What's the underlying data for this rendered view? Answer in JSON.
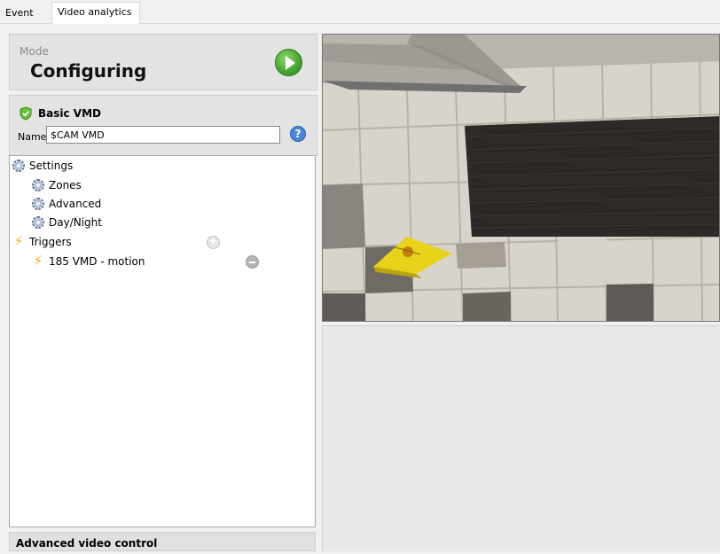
{
  "tabs": [
    {
      "label": "Event"
    },
    {
      "label": "Video analytics"
    }
  ],
  "mode": {
    "label": "Mode",
    "value": "Configuring",
    "play_icon": "play-icon"
  },
  "vmd": {
    "title": "Basic VMD",
    "name_label": "Name",
    "name_value": "$CAM VMD",
    "help_icon": "help-icon"
  },
  "tree": {
    "settings": "Settings",
    "zones": "Zones",
    "advanced": "Advanced",
    "day_night": "Day/Night",
    "triggers": "Triggers",
    "trigger_item": "185 VMD - motion"
  },
  "advanced_video_control": "Advanced video control",
  "colors": {
    "play": "#4aa632",
    "help": "#4a86d8",
    "trigger_bolt": "#f2b010",
    "shield": "#6abf3a"
  }
}
